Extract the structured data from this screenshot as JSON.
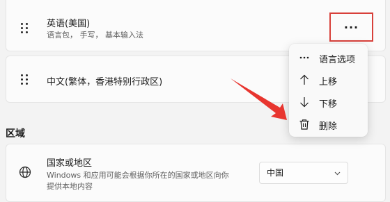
{
  "languages": [
    {
      "name": "英语(美国)",
      "features": "语言包， 手写， 基本输入法"
    },
    {
      "name": "中文(繁体，香港特别行政区)"
    }
  ],
  "more_button": {
    "label": "···",
    "highlight_color": "#d8403a"
  },
  "context_menu": {
    "items": [
      {
        "label": "语言选项",
        "icon": "more-icon"
      },
      {
        "label": "上移",
        "icon": "arrow-up-icon"
      },
      {
        "label": "下移",
        "icon": "arrow-down-icon"
      },
      {
        "label": "删除",
        "icon": "trash-icon"
      }
    ]
  },
  "region": {
    "section_title": "区域",
    "country": {
      "title": "国家或地区",
      "description_line1": "Windows 和应用可能会根据你所在的国家或地区向你",
      "description_line2": "提供本地内容",
      "selected": "中国",
      "icon": "globe-icon"
    }
  },
  "annotation": {
    "color": "#e8352f"
  }
}
